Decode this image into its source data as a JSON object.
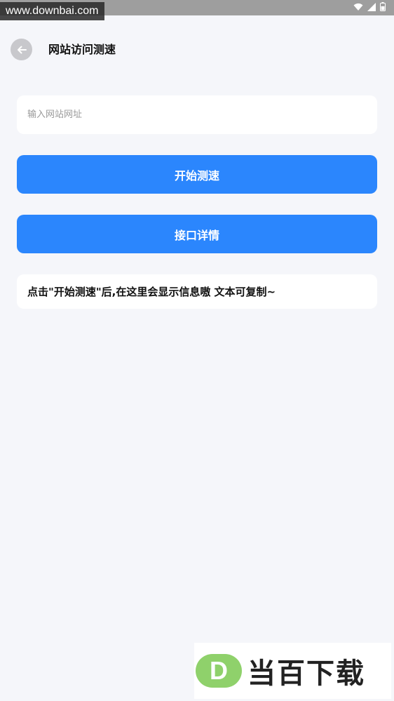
{
  "status_bar": {
    "watermark": "www.downbai.com",
    "icons": [
      "wifi-icon",
      "signal-icon",
      "battery-icon"
    ]
  },
  "header": {
    "back_icon": "arrow-left-icon",
    "title": "网站访问测速"
  },
  "url_input": {
    "placeholder": "输入网站网址",
    "value": ""
  },
  "buttons": {
    "start_label": "开始测速",
    "detail_label": "接口详情"
  },
  "result": {
    "text": "点击\"开始测速\"后,在这里会显示信息嗷 文本可复制~"
  },
  "watermark_bottom": {
    "logo_letter": "D",
    "text": "当百下载"
  },
  "colors": {
    "accent": "#2b86fd",
    "background": "#f5f6fa",
    "card": "#ffffff",
    "status_bar": "#9e9e9e",
    "logo_green": "#8fd16b"
  }
}
